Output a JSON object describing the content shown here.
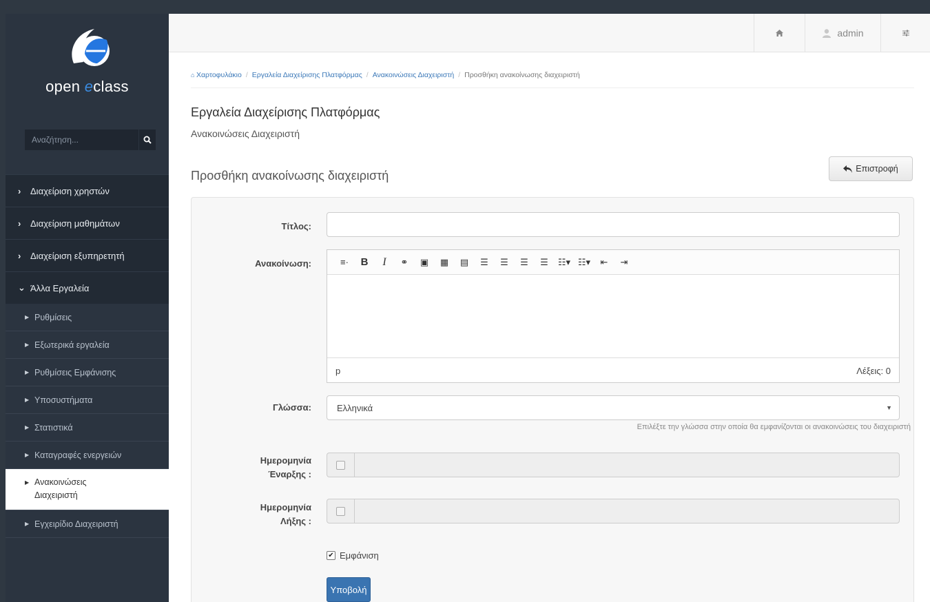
{
  "sidebar": {
    "logo_text_prefix": "open ",
    "logo_text_accent": "e",
    "logo_text_suffix": "class",
    "search_placeholder": "Αναζήτηση...",
    "categories": [
      {
        "label": "Διαχείριση χρηστών",
        "expanded": false
      },
      {
        "label": "Διαχείριση μαθημάτων",
        "expanded": false
      },
      {
        "label": "Διαχείριση εξυπηρετητή",
        "expanded": false
      },
      {
        "label": "Άλλα Εργαλεία",
        "expanded": true
      }
    ],
    "sub_items": [
      {
        "label": "Ρυθμίσεις"
      },
      {
        "label": "Εξωτερικά εργαλεία"
      },
      {
        "label": "Ρυθμίσεις Εμφάνισης"
      },
      {
        "label": "Υποσυστήματα"
      },
      {
        "label": "Στατιστικά"
      },
      {
        "label": "Καταγραφές ενεργειών"
      },
      {
        "label_line1": "Ανακοινώσεις",
        "label_line2": "Διαχειριστή",
        "active": true
      },
      {
        "label": "Εγχειρίδιο Διαχειριστή"
      }
    ]
  },
  "topbar": {
    "home_icon": "home-icon",
    "user_name": "admin",
    "settings_icon": "sliders-icon"
  },
  "breadcrumb": [
    "Χαρτοφυλάκιο",
    "Εργαλεία Διαχείρισης Πλατφόρμας",
    "Ανακοινώσεις Διαχειριστή",
    "Προσθήκη ανακοίνωσης διαχειριστή"
  ],
  "header": {
    "title": "Εργαλεία Διαχείρισης Πλατφόρμας",
    "subtitle": "Ανακοινώσεις Διαχειριστή",
    "section_title": "Προσθήκη ανακοίνωσης διαχειριστή",
    "back_label": "Επιστροφή"
  },
  "form": {
    "title_label": "Τίτλος:",
    "title_value": "",
    "announcement_label": "Ανακοίνωση:",
    "editor_path": "p",
    "editor_words": "Λέξεις: 0",
    "language_label": "Γλώσσα:",
    "language_value": "Ελληνικά",
    "language_help": "Επιλέξτε την γλώσσα στην οποία θα εμφανίζονται οι ανακοινώσεις του διαχειριστή",
    "start_label_1": "Ημερομηνία",
    "start_label_2": "Έναρξης :",
    "end_label_1": "Ημερομηνία",
    "end_label_2": "Λήξης :",
    "show_label": "Εμφάνιση",
    "show_checked": true,
    "submit_label": "Υποβολή"
  },
  "colors": {
    "sidebar_bg": "#2b3440",
    "accent": "#3b78b8",
    "submit": "#3a74b1"
  }
}
